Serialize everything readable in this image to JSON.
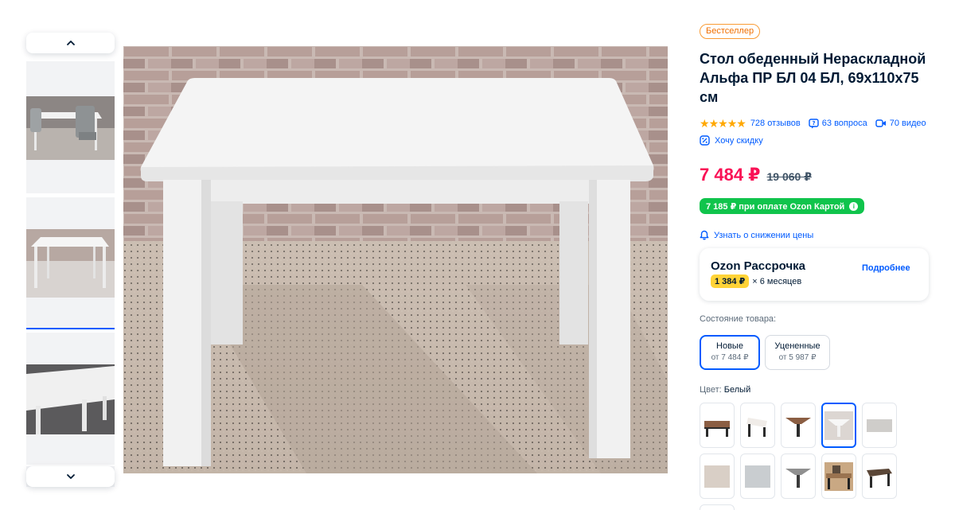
{
  "product": {
    "badge": "Бестселлер",
    "title": "Стол обеденный Нераскладной Альфа ПР БЛ 04 БЛ, 69x110x75 см",
    "rating_stars": 5,
    "reviews": "728 отзывов",
    "questions": "63 вопроса",
    "videos": "70 видео",
    "discount_request": "Хочу скидку"
  },
  "price": {
    "current": "7 484 ₽",
    "old": "19 060 ₽",
    "card_offer": "7 185 ₽ при оплате Ozon Картой",
    "notify": "Узнать о снижении цены"
  },
  "installment": {
    "title": "Ozon Рассрочка",
    "amount": "1 384 ₽",
    "term": "× 6 месяцев",
    "more": "Подробнее"
  },
  "condition": {
    "label": "Состояние товара:",
    "options": [
      {
        "name": "Новые",
        "price": "от 7 484 ₽",
        "selected": true
      },
      {
        "name": "Уцененные",
        "price": "от 5 987 ₽",
        "selected": false
      }
    ]
  },
  "color": {
    "label": "Цвет:",
    "value": "Белый",
    "selected_index": 3
  },
  "colors": {
    "accent": "#005bff",
    "price": "#f91155",
    "card_green": "#10c44c",
    "badge_orange": "#f06f00",
    "star": "#ffa800",
    "installment_yellow": "#ffd337"
  }
}
